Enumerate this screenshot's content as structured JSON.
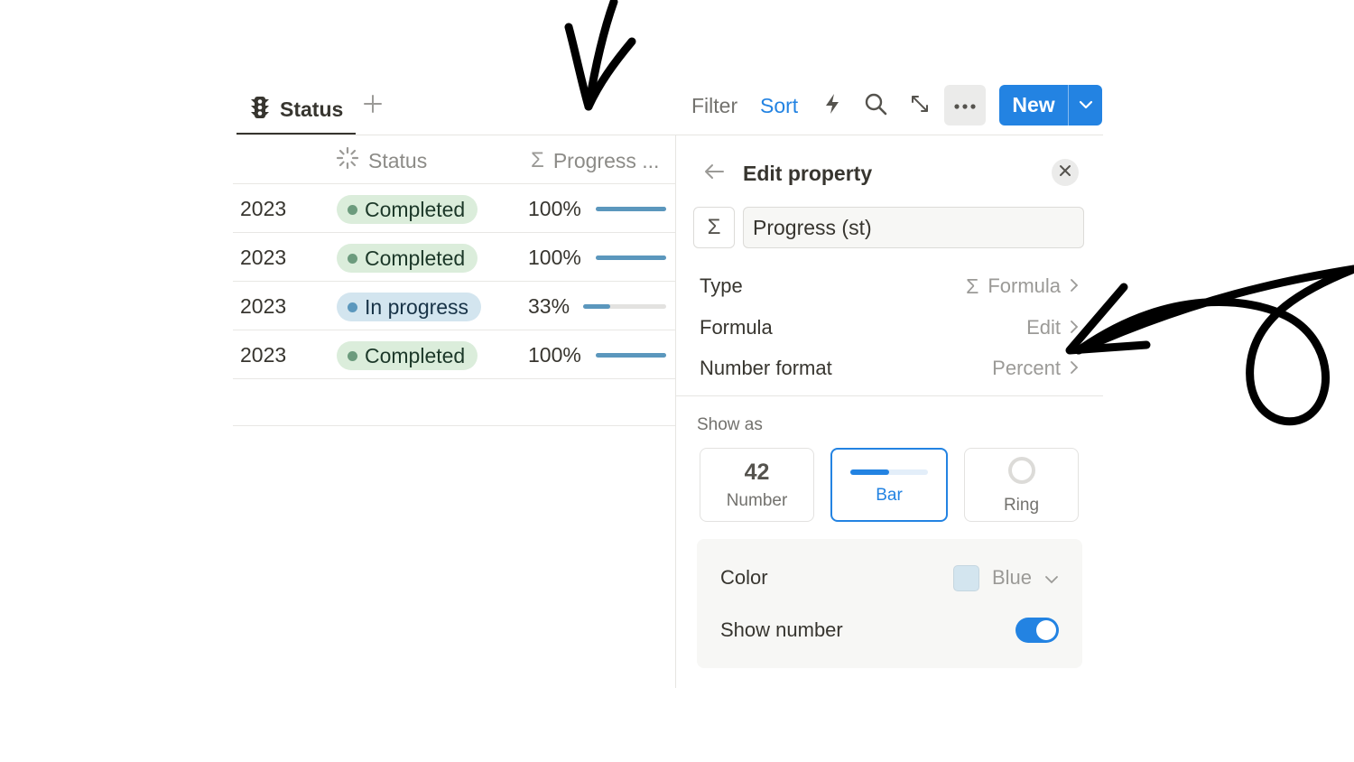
{
  "tabs": {
    "active_label": "Status",
    "add_icon": "plus-icon"
  },
  "toolbar": {
    "filter_label": "Filter",
    "sort_label": "Sort",
    "automation_icon": "lightning-icon",
    "search_icon": "search-icon",
    "expand_icon": "expand-icon",
    "more_icon": "more-dots-icon",
    "new_label": "New",
    "new_dropdown_icon": "chevron-down-icon"
  },
  "table": {
    "columns": [
      {
        "label": "",
        "icon": ""
      },
      {
        "label": "Status",
        "icon": "status-spinner-icon"
      },
      {
        "label": "Progress ...",
        "icon": "sigma-icon"
      }
    ],
    "rows": [
      {
        "year": "2023",
        "status": "Completed",
        "status_color": "green",
        "progress_text": "100%",
        "progress": 1.0
      },
      {
        "year": "2023",
        "status": "Completed",
        "status_color": "green",
        "progress_text": "100%",
        "progress": 1.0
      },
      {
        "year": "2023",
        "status": "In progress",
        "status_color": "blue",
        "progress_text": "33%",
        "progress": 0.33
      },
      {
        "year": "2023",
        "status": "Completed",
        "status_color": "green",
        "progress_text": "100%",
        "progress": 1.0
      }
    ]
  },
  "edit_property": {
    "title": "Edit property",
    "back_icon": "arrow-left-icon",
    "close_icon": "close-icon",
    "property_icon": "Σ",
    "property_name": "Progress (st)",
    "options": [
      {
        "label": "Type",
        "value": "Formula",
        "value_icon": "Σ"
      },
      {
        "label": "Formula",
        "value": "Edit",
        "value_icon": ""
      },
      {
        "label": "Number format",
        "value": "Percent",
        "value_icon": ""
      }
    ],
    "show_as_label": "Show as",
    "show_as": [
      {
        "key": "number",
        "label": "Number",
        "preview": "42",
        "selected": false
      },
      {
        "key": "bar",
        "label": "Bar",
        "preview": "",
        "selected": true
      },
      {
        "key": "ring",
        "label": "Ring",
        "preview": "",
        "selected": false
      }
    ],
    "color_label": "Color",
    "color_value": "Blue",
    "color_hex": "#d3e5ef",
    "show_number_label": "Show number",
    "show_number": true
  },
  "colors": {
    "accent": "#2383e2",
    "bar": "#5b97bd",
    "green_pill": "#dbeddb",
    "blue_pill": "#d3e5ef"
  }
}
